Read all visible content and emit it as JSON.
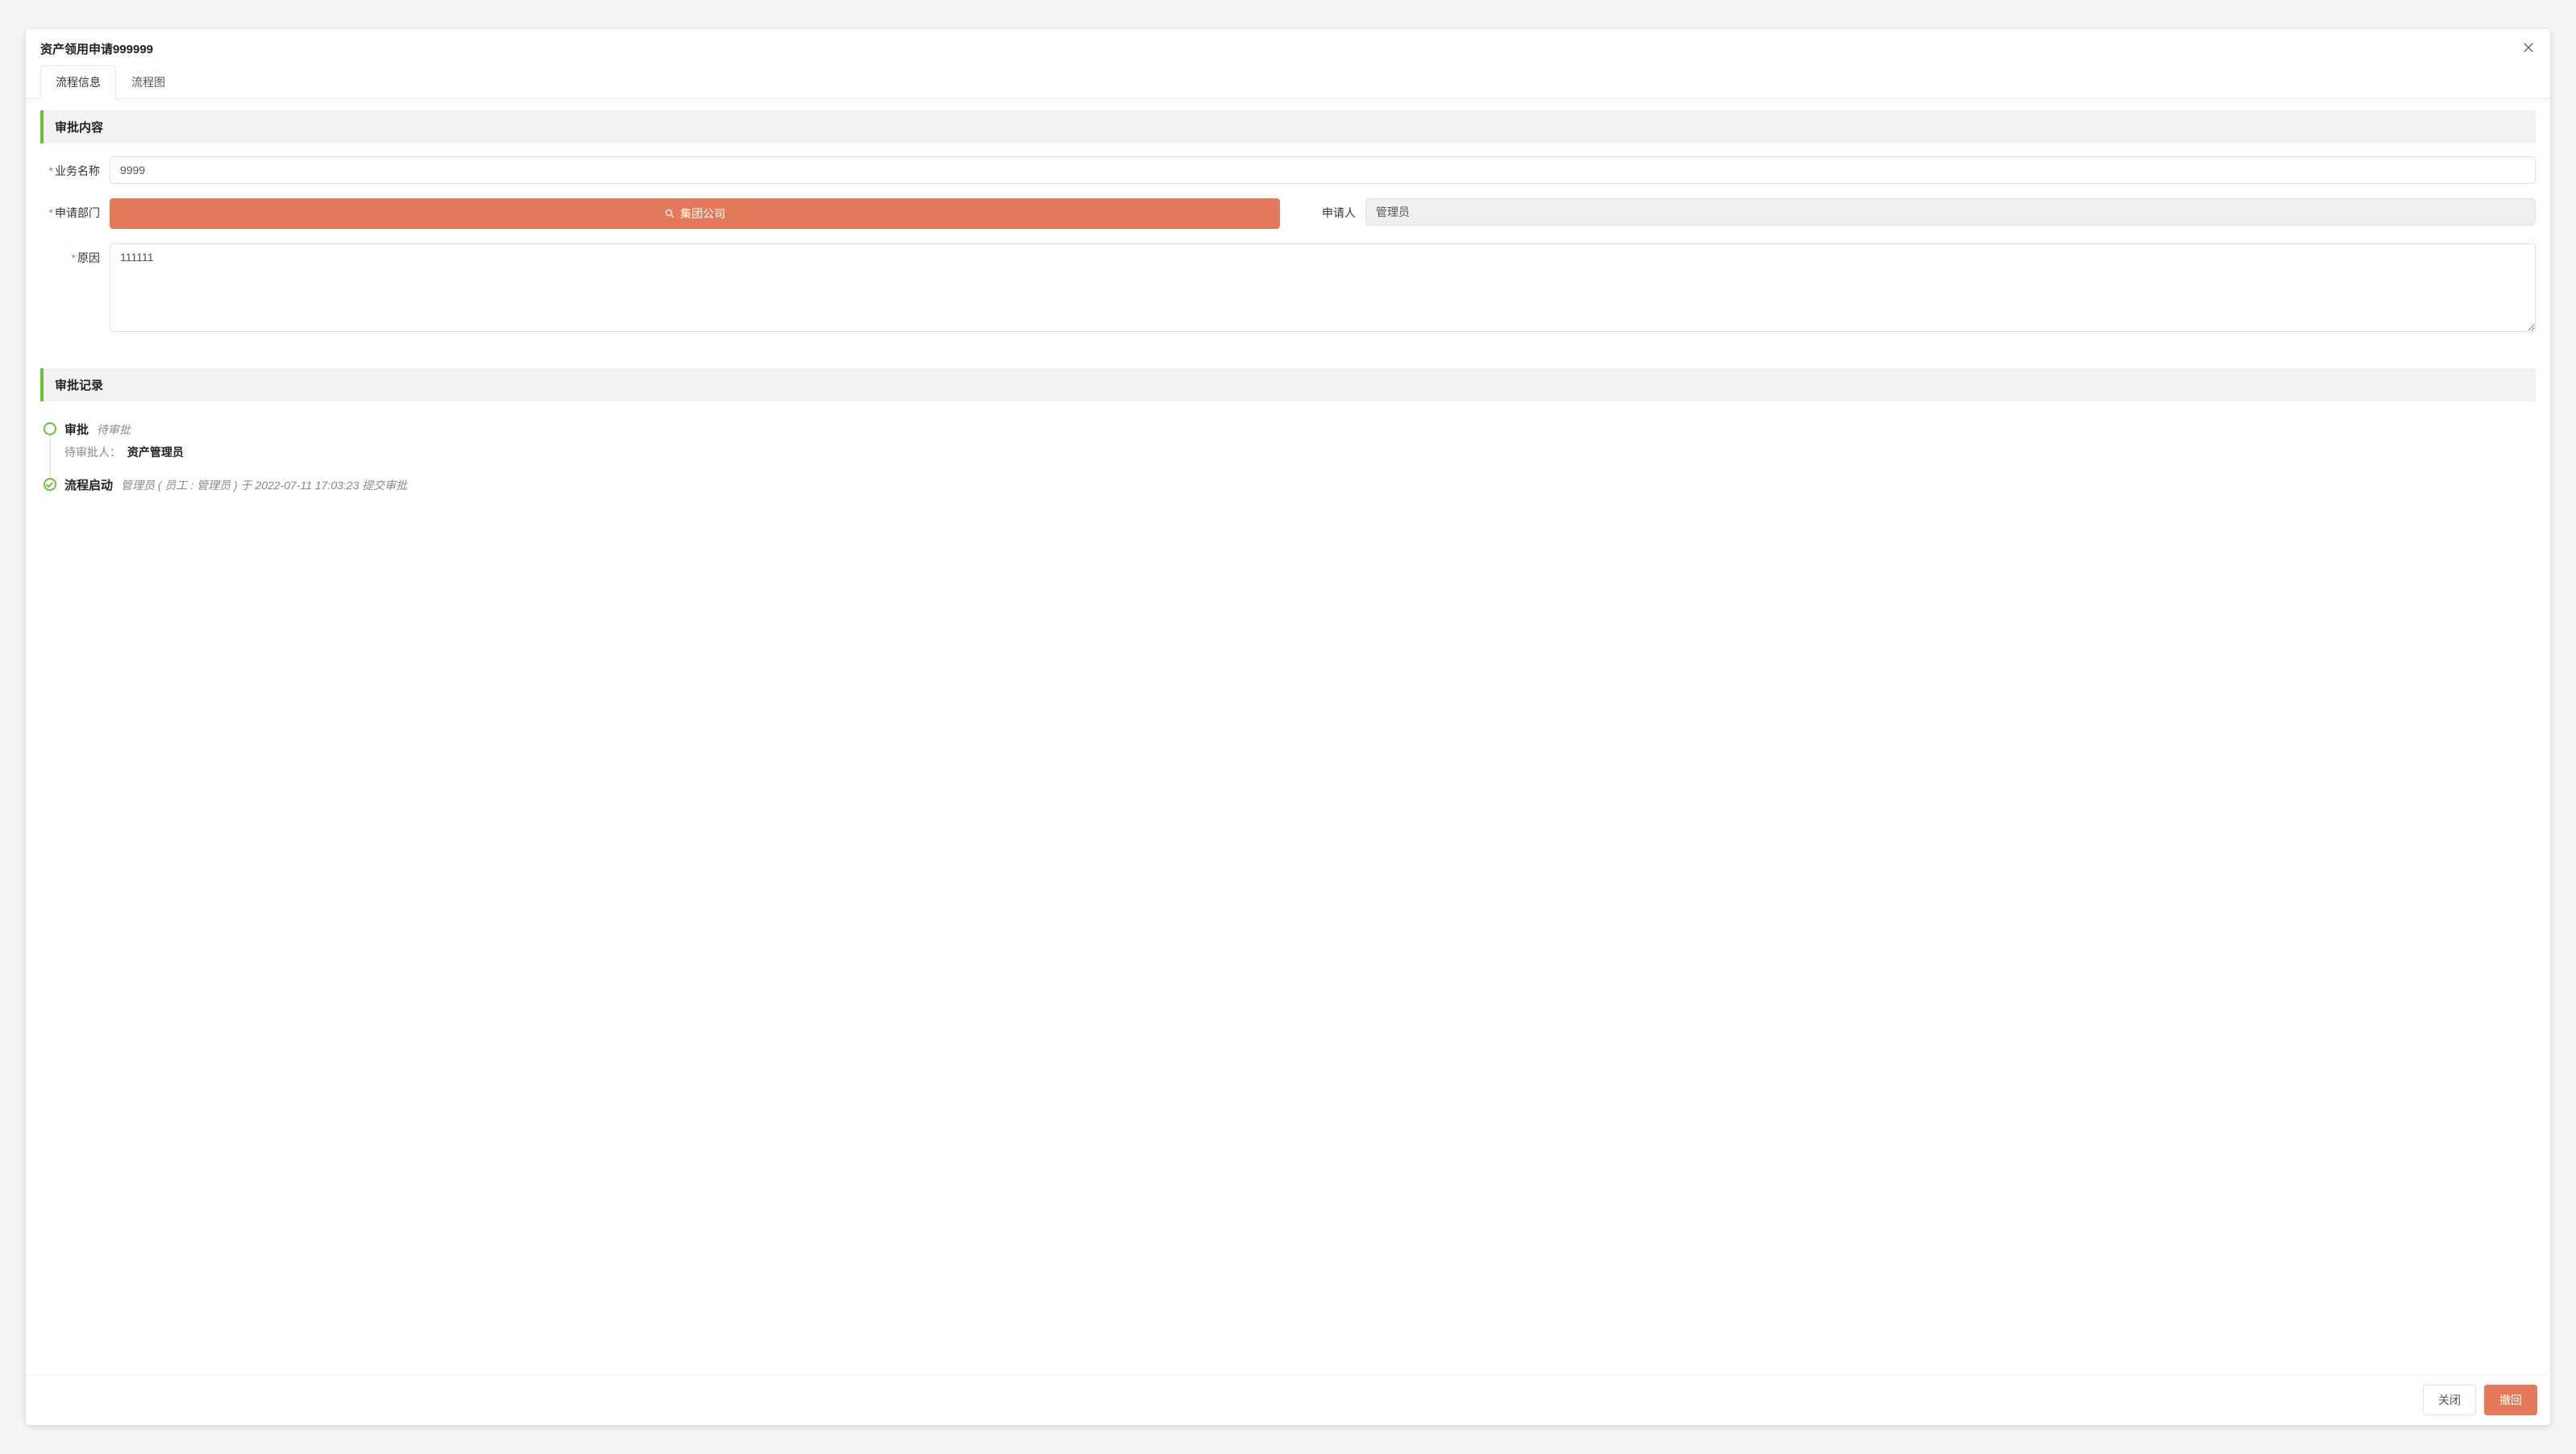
{
  "modal": {
    "title": "资产领用申请999999"
  },
  "tabs": {
    "info": "流程信息",
    "diagram": "流程图"
  },
  "sections": {
    "approvalContent": "审批内容",
    "approvalRecord": "审批记录"
  },
  "form": {
    "businessNameLabel": "业务名称",
    "businessNameValue": "9999",
    "applyDeptLabel": "申请部门",
    "applyDeptValue": "集团公司",
    "applicantLabel": "申请人",
    "applicantValue": "管理员",
    "reasonLabel": "原因",
    "reasonValue": "111111"
  },
  "timeline": {
    "step1": {
      "title": "审批",
      "status": "待审批",
      "pendingLabel": "待审批人：",
      "pendingPerson": "资产管理员"
    },
    "step2": {
      "title": "流程启动",
      "status": "管理员 ( 员工 : 管理员 ) 于 2022-07-11 17:03:23 提交审批"
    }
  },
  "footer": {
    "close": "关闭",
    "withdraw": "撤回"
  }
}
